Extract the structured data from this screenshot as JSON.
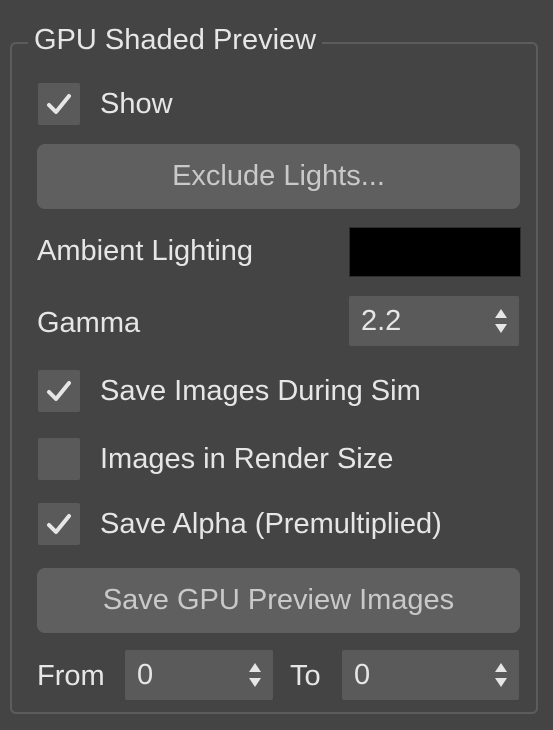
{
  "panel": {
    "title": "GPU Shaded Preview",
    "show": {
      "label": "Show",
      "checked": true
    },
    "exclude_lights_button": "Exclude Lights...",
    "ambient_lighting": {
      "label": "Ambient Lighting",
      "color": "#000000"
    },
    "gamma": {
      "label": "Gamma",
      "value": "2.2"
    },
    "save_images_during_sim": {
      "label": "Save Images During Sim",
      "checked": true
    },
    "images_in_render_size": {
      "label": "Images in Render Size",
      "checked": false
    },
    "save_alpha": {
      "label": "Save Alpha (Premultiplied)",
      "checked": true
    },
    "save_gpu_preview_images_button": "Save GPU Preview Images",
    "from": {
      "label": "From",
      "value": "0"
    },
    "to": {
      "label": "To",
      "value": "0"
    }
  },
  "colors": {
    "background": "#444444",
    "control": "#5a5a5a",
    "button": "#5f5f5f",
    "text": "#e6e6e6"
  }
}
